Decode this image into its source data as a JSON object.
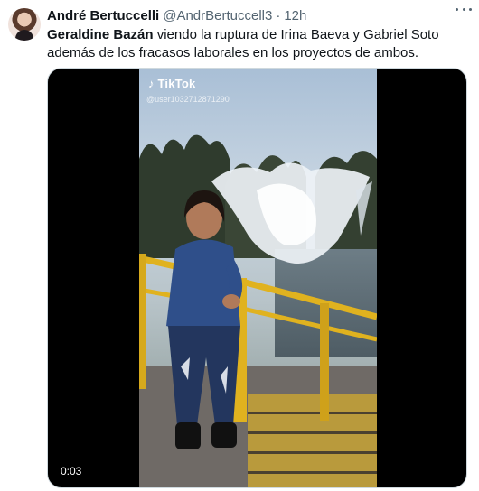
{
  "author": {
    "display_name": "André Bertuccelli",
    "handle": "@AndrBertuccell3",
    "separator": "·",
    "time": "12h"
  },
  "tweet": {
    "bold_name": "Geraldine Bazán",
    "text_rest": " viendo la ruptura de Irina Baeva y Gabriel Soto además de los fracasos laborales en los proyectos de ambos."
  },
  "video": {
    "watermark_brand": "TikTok",
    "watermark_user": "@user1032712871290",
    "duration": "0:03"
  },
  "icons": {
    "more": "more-dots-icon",
    "tiktok": "tiktok-note-icon"
  },
  "colors": {
    "text_primary": "#0f1419",
    "text_secondary": "#536471",
    "railing": "#e0b21f",
    "jacket": "#2f4f8a"
  }
}
